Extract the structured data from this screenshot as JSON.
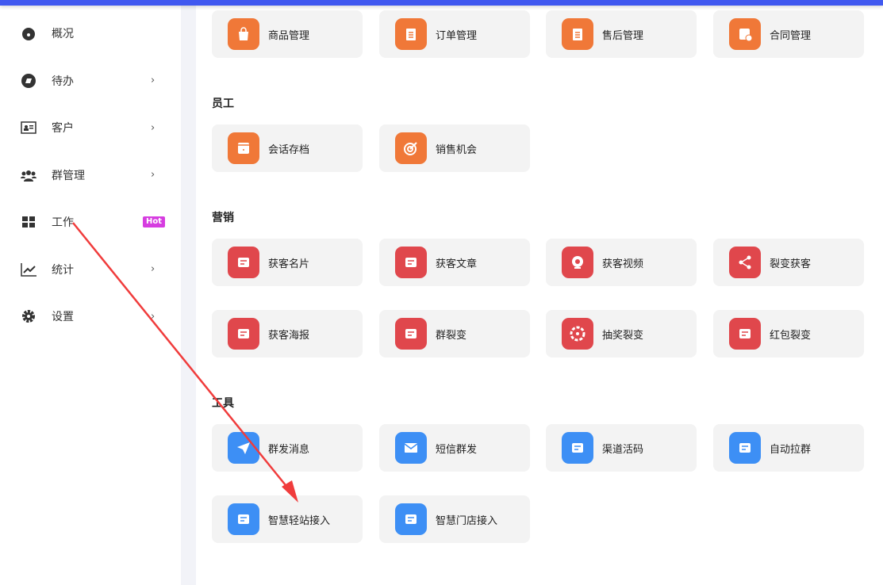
{
  "colors": {
    "orange": "#f07838",
    "red": "#e0474c",
    "blue": "#3d8ff5",
    "accent": "#4159f0",
    "hot": "#d63de0"
  },
  "sidebar": {
    "items": [
      {
        "label": "概况",
        "icon": "dashboard-icon",
        "chevron": false
      },
      {
        "label": "待办",
        "icon": "todo-icon",
        "chevron": true
      },
      {
        "label": "客户",
        "icon": "id-card-icon",
        "chevron": true
      },
      {
        "label": "群管理",
        "icon": "group-icon",
        "chevron": true
      },
      {
        "label": "工作",
        "icon": "grid-icon",
        "chevron": false,
        "badge": "Hot"
      },
      {
        "label": "统计",
        "icon": "chart-line-icon",
        "chevron": true
      },
      {
        "label": "设置",
        "icon": "gear-icon",
        "chevron": true
      }
    ],
    "chevron": "›"
  },
  "sections": [
    {
      "title": "",
      "color": "orange",
      "items": [
        {
          "label": "商品管理",
          "icon": "shopping-bag-icon"
        },
        {
          "label": "订单管理",
          "icon": "clipboard-icon"
        },
        {
          "label": "售后管理",
          "icon": "clipboard-icon"
        },
        {
          "label": "合同管理",
          "icon": "contract-icon"
        }
      ]
    },
    {
      "title": "员工",
      "color": "orange",
      "items": [
        {
          "label": "会话存档",
          "icon": "archive-icon"
        },
        {
          "label": "销售机会",
          "icon": "target-icon"
        }
      ]
    },
    {
      "title": "营销",
      "color": "red",
      "items": [
        {
          "label": "获客名片",
          "icon": "card-icon"
        },
        {
          "label": "获客文章",
          "icon": "article-icon"
        },
        {
          "label": "获客视频",
          "icon": "video-icon"
        },
        {
          "label": "裂变获客",
          "icon": "share-icon"
        },
        {
          "label": "获客海报",
          "icon": "poster-icon"
        },
        {
          "label": "群裂变",
          "icon": "group-icon"
        },
        {
          "label": "抽奖裂变",
          "icon": "wheel-icon"
        },
        {
          "label": "红包裂变",
          "icon": "red-packet-icon"
        }
      ]
    },
    {
      "title": "工具",
      "color": "blue",
      "items": [
        {
          "label": "群发消息",
          "icon": "send-icon"
        },
        {
          "label": "短信群发",
          "icon": "mail-icon"
        },
        {
          "label": "渠道活码",
          "icon": "qrcode-icon"
        },
        {
          "label": "自动拉群",
          "icon": "auto-group-icon"
        },
        {
          "label": "智慧轻站接入",
          "icon": "monitor-link-icon"
        },
        {
          "label": "智慧门店接入",
          "icon": "store-link-icon"
        }
      ]
    }
  ]
}
